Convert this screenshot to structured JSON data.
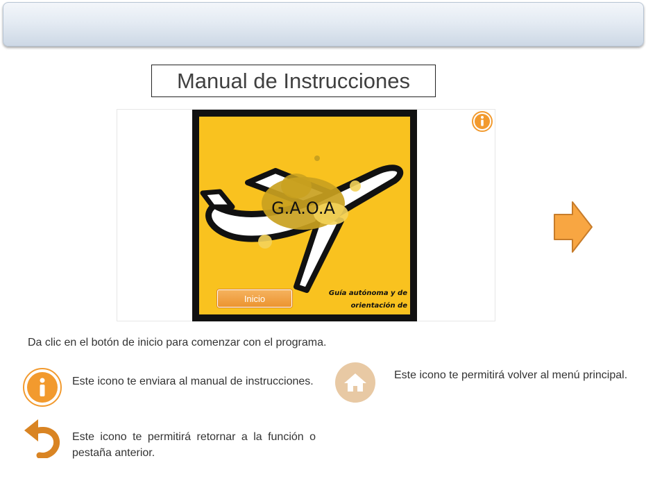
{
  "header": {
    "title": "Manual de Instrucciones"
  },
  "poster": {
    "logo_text": "G.A.O.A",
    "tagline_line1": "Guía autónoma y de",
    "tagline_line2": "orientación de aeropuertos.",
    "start_button": "Inicio"
  },
  "instruction": "Da clic en el botón de inicio para comenzar con el programa.",
  "legend": [
    {
      "icon": "info-icon",
      "text": "Este icono te enviara al manual de instrucciones."
    },
    {
      "icon": "back-arrow-icon",
      "text": "Este icono te permitirá retornar a la función o pestaña anterior."
    },
    {
      "icon": "home-icon",
      "text": "Este icono te permitirá volver al menú principal."
    }
  ],
  "colors": {
    "accent": "#f29a2e",
    "poster_bg": "#f9c21f",
    "home_icon": "#e8c9a4"
  }
}
